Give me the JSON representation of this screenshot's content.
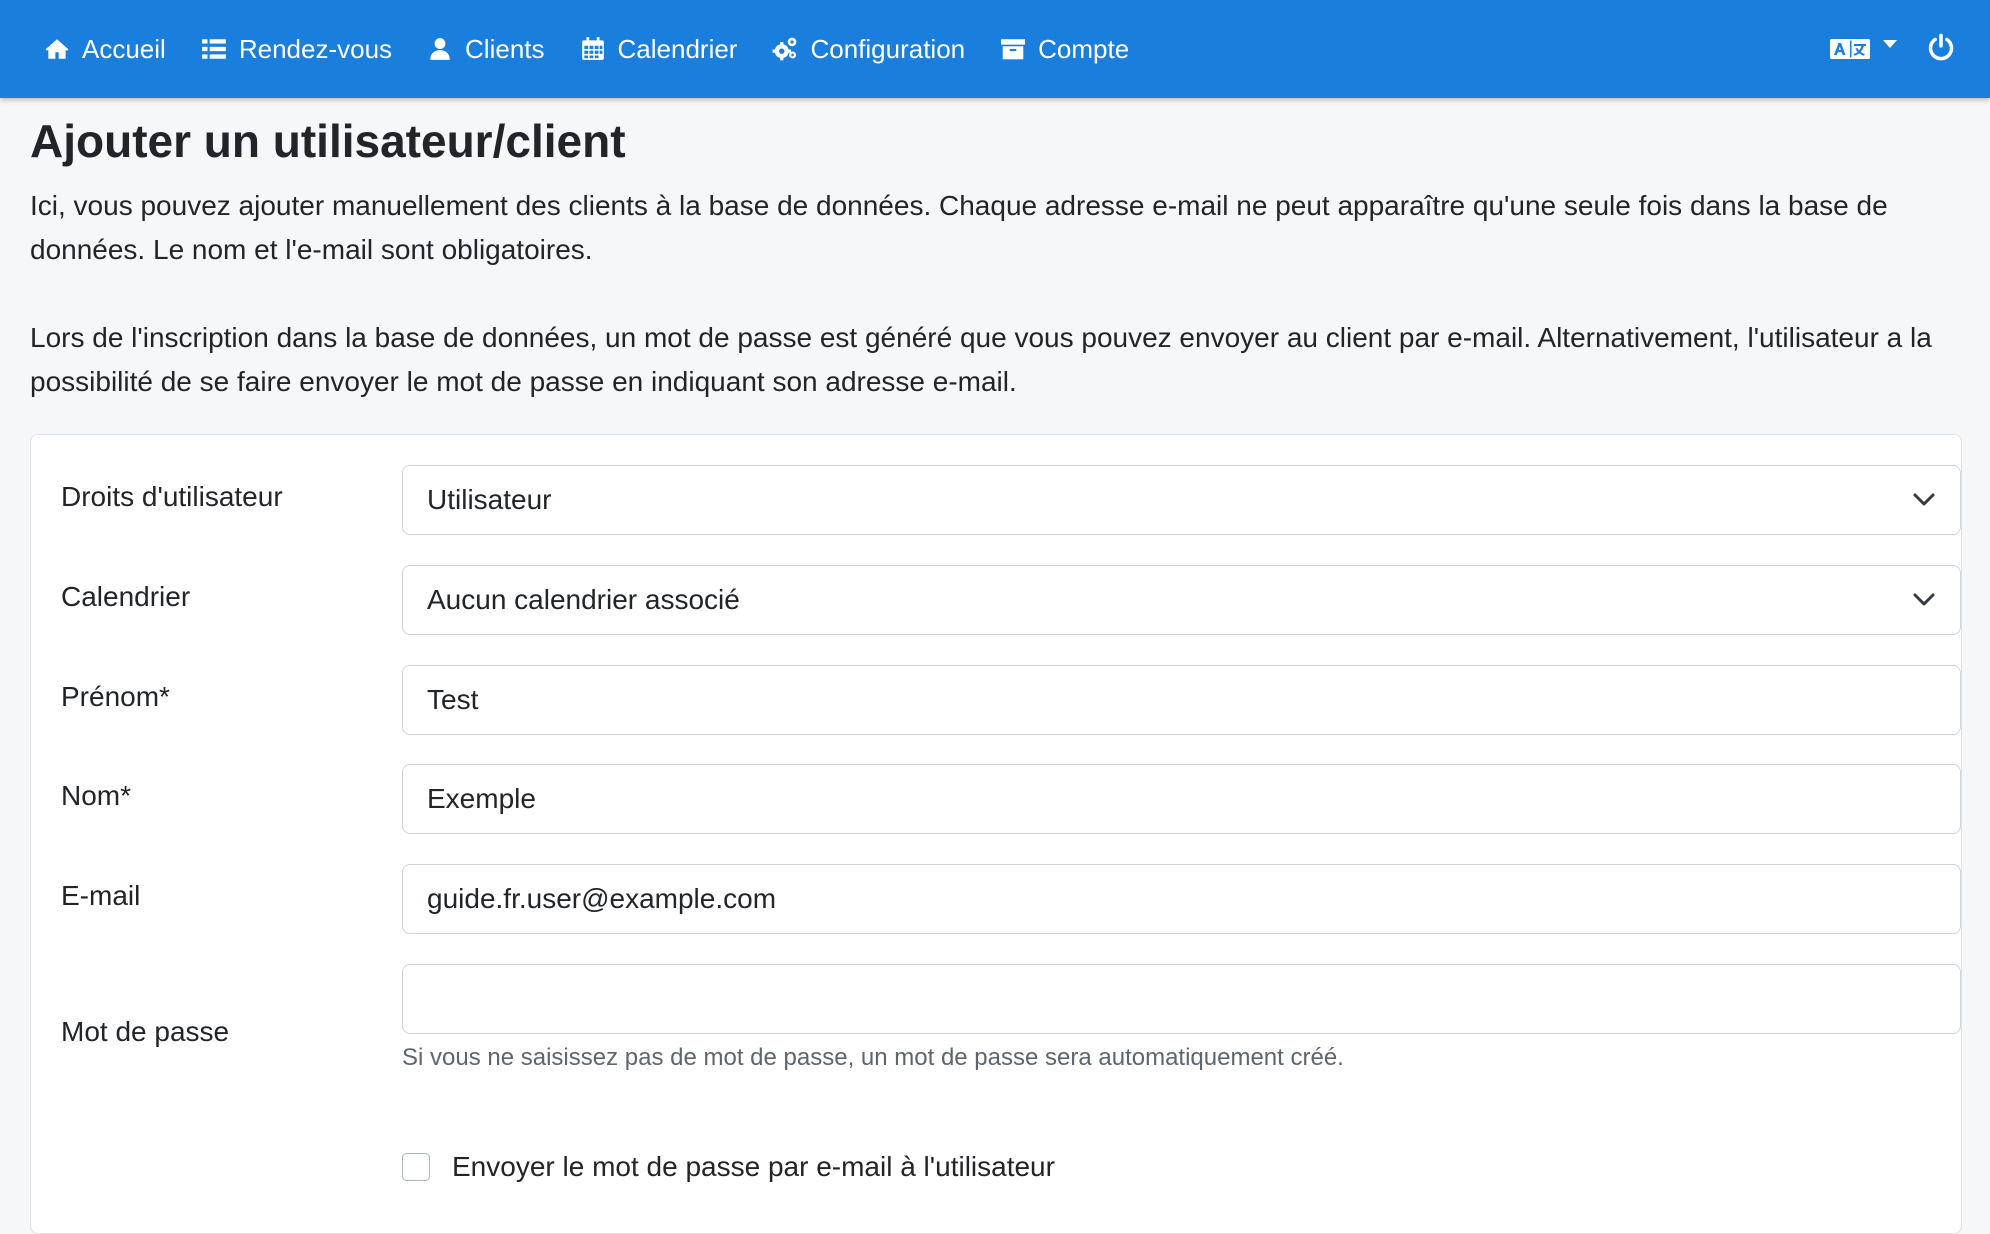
{
  "nav": {
    "items": [
      {
        "label": "Accueil",
        "icon": "home-icon"
      },
      {
        "label": "Rendez-vous",
        "icon": "list-icon"
      },
      {
        "label": "Clients",
        "icon": "user-icon"
      },
      {
        "label": "Calendrier",
        "icon": "calendar-icon"
      },
      {
        "label": "Configuration",
        "icon": "cogs-icon"
      },
      {
        "label": "Compte",
        "icon": "archive-icon"
      }
    ],
    "right": {
      "language_icon": "language-icon",
      "logout_icon": "power-icon"
    },
    "bg_color": "#1a7fdc"
  },
  "page": {
    "title": "Ajouter un utilisateur/client",
    "intro_1": "Ici, vous pouvez ajouter manuellement des clients à la base de données. Chaque adresse e-mail ne peut apparaître qu'une seule fois dans la base de données. Le nom et l'e-mail sont obligatoires.",
    "intro_2": "Lors de l'inscription dans la base de données, un mot de passe est généré que vous pouvez envoyer au client par e-mail. Alternativement, l'utilisateur a la possibilité de se faire envoyer le mot de passe en indiquant son adresse e-mail."
  },
  "form": {
    "rights": {
      "label": "Droits d'utilisateur",
      "value": "Utilisateur"
    },
    "calendar": {
      "label": "Calendrier",
      "value": "Aucun calendrier associé"
    },
    "firstname": {
      "label": "Prénom*",
      "value": "Test"
    },
    "lastname": {
      "label": "Nom*",
      "value": "Exemple"
    },
    "email": {
      "label": "E-mail",
      "value": "guide.fr.user@example.com"
    },
    "password": {
      "label": "Mot de passe",
      "value": "",
      "help": "Si vous ne saisissez pas de mot de passe, un mot de passe sera automatiquement créé."
    },
    "send_password": {
      "label": "Envoyer le mot de passe par e-mail à l'utilisateur",
      "checked": false
    }
  }
}
